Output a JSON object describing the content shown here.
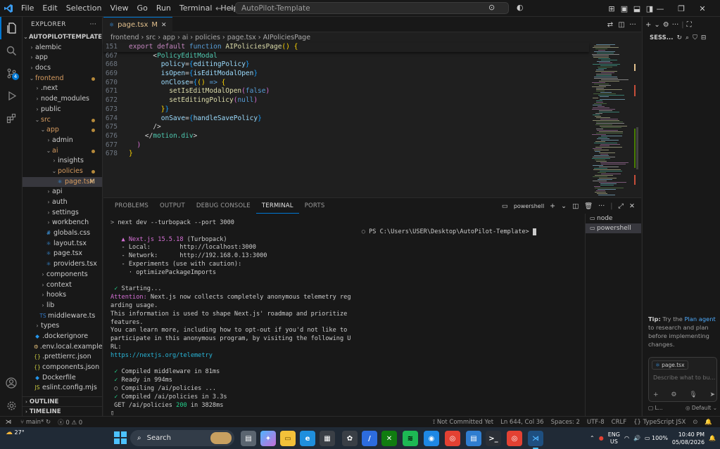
{
  "titlebar": {
    "menus": [
      "File",
      "Edit",
      "Selection",
      "View",
      "Go",
      "Run",
      "Terminal",
      "Help"
    ],
    "search_text": "AutoPilot-Template"
  },
  "explorer": {
    "title": "EXPLORER",
    "root": "AUTOPILOT-TEMPLATE",
    "items": [
      {
        "label": "alembic",
        "depth": 0,
        "type": "folder",
        "open": false,
        "mod": ""
      },
      {
        "label": "app",
        "depth": 0,
        "type": "folder",
        "open": false,
        "mod": ""
      },
      {
        "label": "docs",
        "depth": 0,
        "type": "folder",
        "open": false,
        "mod": ""
      },
      {
        "label": "frontend",
        "depth": 0,
        "type": "folder",
        "open": true,
        "mod": "dot"
      },
      {
        "label": ".next",
        "depth": 1,
        "type": "folder",
        "open": false,
        "mod": ""
      },
      {
        "label": "node_modules",
        "depth": 1,
        "type": "folder",
        "open": false,
        "mod": ""
      },
      {
        "label": "public",
        "depth": 1,
        "type": "folder",
        "open": false,
        "mod": ""
      },
      {
        "label": "src",
        "depth": 1,
        "type": "folder",
        "open": true,
        "mod": "dot"
      },
      {
        "label": "app",
        "depth": 2,
        "type": "folder",
        "open": true,
        "mod": "dot"
      },
      {
        "label": "admin",
        "depth": 3,
        "type": "folder",
        "open": false,
        "mod": ""
      },
      {
        "label": "ai",
        "depth": 3,
        "type": "folder",
        "open": true,
        "mod": "dot"
      },
      {
        "label": "insights",
        "depth": 4,
        "type": "folder",
        "open": false,
        "mod": ""
      },
      {
        "label": "policies",
        "depth": 4,
        "type": "folder",
        "open": true,
        "mod": "dot"
      },
      {
        "label": "page.tsx",
        "depth": 5,
        "type": "tsx",
        "open": false,
        "mod": "M",
        "selected": true
      },
      {
        "label": "api",
        "depth": 3,
        "type": "folder",
        "open": false,
        "mod": ""
      },
      {
        "label": "auth",
        "depth": 3,
        "type": "folder",
        "open": false,
        "mod": ""
      },
      {
        "label": "settings",
        "depth": 3,
        "type": "folder",
        "open": false,
        "mod": ""
      },
      {
        "label": "workbench",
        "depth": 3,
        "type": "folder",
        "open": false,
        "mod": ""
      },
      {
        "label": "globals.css",
        "depth": 3,
        "type": "css",
        "open": false,
        "mod": ""
      },
      {
        "label": "layout.tsx",
        "depth": 3,
        "type": "tsx",
        "open": false,
        "mod": ""
      },
      {
        "label": "page.tsx",
        "depth": 3,
        "type": "tsx",
        "open": false,
        "mod": ""
      },
      {
        "label": "providers.tsx",
        "depth": 3,
        "type": "tsx",
        "open": false,
        "mod": ""
      },
      {
        "label": "components",
        "depth": 2,
        "type": "folder",
        "open": false,
        "mod": ""
      },
      {
        "label": "context",
        "depth": 2,
        "type": "folder",
        "open": false,
        "mod": ""
      },
      {
        "label": "hooks",
        "depth": 2,
        "type": "folder",
        "open": false,
        "mod": ""
      },
      {
        "label": "lib",
        "depth": 2,
        "type": "folder",
        "open": false,
        "mod": ""
      },
      {
        "label": "middleware.ts",
        "depth": 2,
        "type": "ts",
        "open": false,
        "mod": ""
      },
      {
        "label": "types",
        "depth": 1,
        "type": "folder",
        "open": false,
        "mod": ""
      },
      {
        "label": ".dockerignore",
        "depth": 1,
        "type": "docker",
        "open": false,
        "mod": ""
      },
      {
        "label": ".env.local.example",
        "depth": 1,
        "type": "env",
        "open": false,
        "mod": ""
      },
      {
        "label": ".prettierrc.json",
        "depth": 1,
        "type": "json",
        "open": false,
        "mod": ""
      },
      {
        "label": "components.json",
        "depth": 1,
        "type": "json",
        "open": false,
        "mod": ""
      },
      {
        "label": "Dockerfile",
        "depth": 1,
        "type": "docker",
        "open": false,
        "mod": ""
      },
      {
        "label": "eslint.config.mjs",
        "depth": 1,
        "type": "js",
        "open": false,
        "mod": ""
      }
    ],
    "outline": "OUTLINE",
    "timeline": "TIMELINE"
  },
  "editor": {
    "tab_label": "page.tsx",
    "tab_mod": "M",
    "breadcrumb": [
      "frontend",
      "src",
      "app",
      "ai",
      "policies",
      "page.tsx",
      "AIPoliciesPage"
    ],
    "sticky": {
      "ln": "151",
      "html": "<span class=\"kw\">export</span> <span class=\"kw\">default</span> <span class=\"kwb\">function</span> <span class=\"fn\">AIPoliciesPage</span><span class=\"brace2\">()</span> <span class=\"brace2\">{</span>"
    },
    "lines": [
      {
        "ln": "667",
        "html": "      <span class=\"dim\">&lt;</span><span class=\"tag\">PolicyEditModal</span>"
      },
      {
        "ln": "668",
        "html": "        <span class=\"attr\">policy</span>=<span class=\"brace3\">{</span><span class=\"attr\">editingPolicy</span><span class=\"brace3\">}</span>"
      },
      {
        "ln": "669",
        "html": "        <span class=\"attr\">isOpen</span>=<span class=\"brace3\">{</span><span class=\"attr\">isEditModalOpen</span><span class=\"brace3\">}</span>"
      },
      {
        "ln": "670",
        "html": "        <span class=\"attr\">onClose</span>=<span class=\"brace3\">{</span><span class=\"brace2\">()</span> <span class=\"kwb\">=&gt;</span> <span class=\"brace2\">{</span>"
      },
      {
        "ln": "671",
        "html": "          <span class=\"fn\">setIsEditModalOpen</span><span class=\"brace\">(</span><span class=\"lit\">false</span><span class=\"brace\">)</span>"
      },
      {
        "ln": "672",
        "html": "          <span class=\"fn\">setEditingPolicy</span><span class=\"brace\">(</span><span class=\"lit\">null</span><span class=\"brace\">)</span>"
      },
      {
        "ln": "673",
        "html": "        <span class=\"brace2\">}</span><span class=\"brace3\">}</span>"
      },
      {
        "ln": "674",
        "html": "        <span class=\"attr\">onSave</span>=<span class=\"brace3\">{</span><span class=\"attr\">handleSavePolicy</span><span class=\"brace3\">}</span>"
      },
      {
        "ln": "675",
        "html": "      <span class=\"dim\">/&gt;</span>"
      },
      {
        "ln": "676",
        "html": "    <span class=\"dim\">&lt;/</span><span class=\"tag\">motion.div</span><span class=\"dim\">&gt;</span>"
      },
      {
        "ln": "677",
        "html": "  <span class=\"brace\">)</span>"
      },
      {
        "ln": "678",
        "html": "<span class=\"brace2\">}</span>"
      }
    ]
  },
  "panel": {
    "tabs": [
      "PROBLEMS",
      "OUTPUT",
      "DEBUG CONSOLE",
      "TERMINAL",
      "PORTS"
    ],
    "active_tab": "TERMINAL",
    "shell_label": "powershell",
    "prompt": "PS C:\\Users\\USER\\Desktop\\AutoPilot-Template> ",
    "terminals": [
      "node",
      "powershell"
    ],
    "terminal_lines": [
      {
        "html": "<span class=\"dim\">&gt;</span> next dev --turbopack --port 3000"
      },
      {
        "html": ""
      },
      {
        "html": "   <span class=\"magenta\">▲ Next.js 15.5.18</span> (Turbopack)"
      },
      {
        "html": "   - Local:        http://localhost:3000"
      },
      {
        "html": "   - Network:      http://192.168.0.13:3000"
      },
      {
        "html": "   - Experiments (use with caution):"
      },
      {
        "html": "     · optimizePackageImports"
      },
      {
        "html": ""
      },
      {
        "html": " <span class=\"green\">✓</span> Starting..."
      },
      {
        "html": "<span class=\"magenta\">Attention:</span> Next.js now collects completely anonymous telemetry reg"
      },
      {
        "html": "arding usage."
      },
      {
        "html": "This information is used to shape Next.js' roadmap and prioritize"
      },
      {
        "html": "features."
      },
      {
        "html": "You can learn more, including how to opt-out if you'd not like to"
      },
      {
        "html": "participate in this anonymous program, by visiting the following U"
      },
      {
        "html": "RL:"
      },
      {
        "html": "<span class=\"cyan\">https://nextjs.org/telemetry</span>"
      },
      {
        "html": ""
      },
      {
        "html": " <span class=\"green\">✓</span> Compiled middleware in 81ms"
      },
      {
        "html": " <span class=\"green\">✓</span> Ready in 994ms"
      },
      {
        "html": " ○ Compiling /ai/policies ..."
      },
      {
        "html": " <span class=\"green\">✓</span> Compiled /ai/policies in 3.3s"
      },
      {
        "html": " GET /ai/policies <span class=\"green\">200</span> in 3828ms"
      },
      {
        "html": "▯"
      }
    ]
  },
  "chat": {
    "title": "SESS...",
    "tip_label": "Tip:",
    "tip_prefix": "Try the",
    "tip_link": "Plan agent",
    "tip_rest": "to research and plan before implementing changes.",
    "context_file": "page.tsx",
    "input_placeholder": "Describe what to bu...",
    "agent_label": "L...",
    "model_label": "Default"
  },
  "statusbar": {
    "branch": "main*",
    "errors": "0",
    "warnings": "0",
    "not_committed": "Not Committed Yet",
    "position": "Ln 644, Col 36",
    "spaces": "Spaces: 2",
    "encoding": "UTF-8",
    "eol": "CRLF",
    "language": "TypeScript JSX"
  },
  "taskbar": {
    "temperature": "27°",
    "search_label": "Search",
    "lang_top": "ENG",
    "lang_bottom": "US",
    "battery": "100%",
    "time": "10:40 PM",
    "date": "05/08/2026"
  },
  "colors": {
    "accent": "#0078d4",
    "modified": "#e2c08d",
    "editor_bg": "#1f1f1f",
    "chrome_bg": "#181818"
  }
}
